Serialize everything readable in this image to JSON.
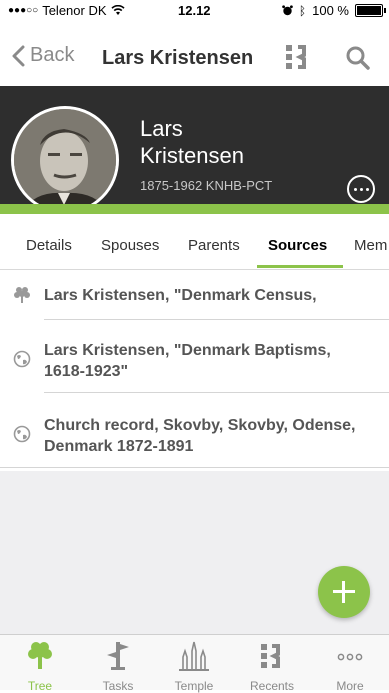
{
  "status_bar": {
    "carrier": "Telenor DK",
    "time": "12.12",
    "battery": "100 %"
  },
  "nav": {
    "back_label": "Back",
    "title": "Lars Kristensen",
    "icons": [
      "pedigree-icon",
      "search-icon"
    ]
  },
  "person": {
    "first_name": "Lars",
    "last_name": "Kristensen",
    "lifespan_id": "1875-1962  KNHB-PCT"
  },
  "tabs": [
    {
      "label": "Details"
    },
    {
      "label": "Spouses"
    },
    {
      "label": "Parents"
    },
    {
      "label": "Sources",
      "active": true
    },
    {
      "label": "Mem"
    }
  ],
  "sources": [
    {
      "icon": "tree-icon",
      "title": "Lars Kristensen, \"Denmark Census,"
    },
    {
      "icon": "globe-icon",
      "title": "Lars Kristensen, \"Denmark Baptisms, 1618-1923\""
    },
    {
      "icon": "globe-icon",
      "title": "Church record, Skovby, Skovby, Odense, Denmark 1872-1891"
    }
  ],
  "tab_bar": [
    {
      "label": "Tree",
      "icon": "tree-icon",
      "active": true
    },
    {
      "label": "Tasks",
      "icon": "tasks-icon"
    },
    {
      "label": "Temple",
      "icon": "temple-icon"
    },
    {
      "label": "Recents",
      "icon": "recents-icon"
    },
    {
      "label": "More",
      "icon": "more-icon"
    }
  ],
  "colors": {
    "accent": "#8cc34a",
    "header_bg": "#2e2e2e"
  }
}
